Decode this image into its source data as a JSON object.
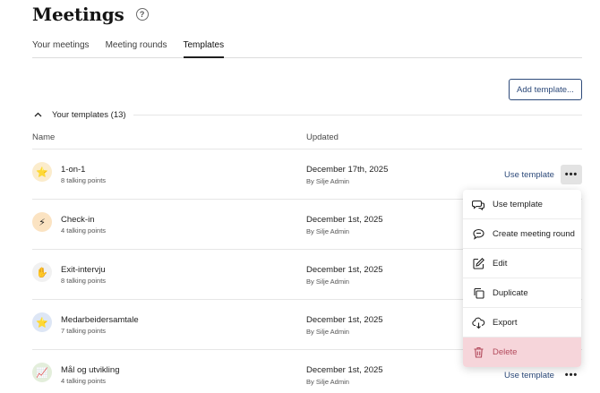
{
  "header": {
    "title": "Meetings",
    "help_glyph": "?"
  },
  "tabs": [
    {
      "label": "Your meetings",
      "active": false
    },
    {
      "label": "Meeting rounds",
      "active": false
    },
    {
      "label": "Templates",
      "active": true
    }
  ],
  "add_button_label": "Add template...",
  "group": {
    "label": "Your templates (13)",
    "expanded": true
  },
  "columns": {
    "name": "Name",
    "updated": "Updated"
  },
  "use_template_label": "Use template",
  "more_glyph": "•••",
  "rows": [
    {
      "name": "1-on-1",
      "talking_points": "8 talking points",
      "date": "December 17th, 2025",
      "by": "By Silje Admin",
      "icon": "star-icon",
      "glyph": "⭐",
      "icon_bg": "#fbeccc"
    },
    {
      "name": "Check-in",
      "talking_points": "4 talking points",
      "date": "December 1st, 2025",
      "by": "By Silje Admin",
      "icon": "lightning-icon",
      "glyph": "⚡",
      "icon_bg": "#fbe3c2"
    },
    {
      "name": "Exit-intervju",
      "talking_points": "8 talking points",
      "date": "December 1st, 2025",
      "by": "By Silje Admin",
      "icon": "wave-icon",
      "glyph": "✋",
      "icon_bg": "#f1f1f1"
    },
    {
      "name": "Medarbeidersamtale",
      "talking_points": "7 talking points",
      "date": "December 1st, 2025",
      "by": "By Silje Admin",
      "icon": "star-icon",
      "glyph": "⭐",
      "icon_bg": "#dde6f5"
    },
    {
      "name": "Mål og utvikling",
      "talking_points": "4 talking points",
      "date": "December 1st, 2025",
      "by": "By Silje Admin",
      "icon": "chart-icon",
      "glyph": "📈",
      "icon_bg": "#e3eedb"
    }
  ],
  "menu": [
    {
      "label": "Use template",
      "icon": "chat-bubbles-icon"
    },
    {
      "label": "Create meeting round",
      "icon": "chat-round-icon"
    },
    {
      "label": "Edit",
      "icon": "edit-icon"
    },
    {
      "label": "Duplicate",
      "icon": "duplicate-icon"
    },
    {
      "label": "Export",
      "icon": "export-icon"
    },
    {
      "label": "Delete",
      "icon": "trash-icon"
    }
  ],
  "colors": {
    "accent": "#2d4a7a",
    "danger_bg": "#f6d5da",
    "danger_text": "#b34a5c"
  }
}
